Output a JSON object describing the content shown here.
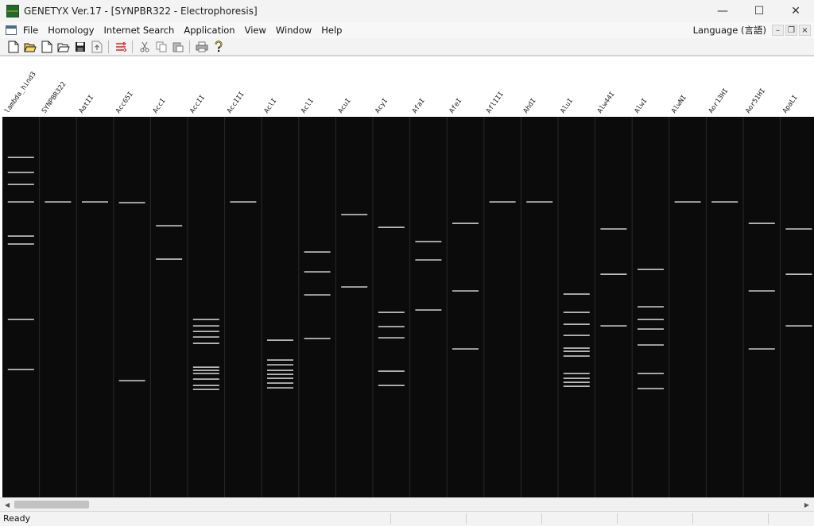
{
  "window": {
    "title": "GENETYX Ver.17 - [SYNPBR322 - Electrophoresis]",
    "minimize": "—",
    "maximize": "☐",
    "close": "✕"
  },
  "menu": {
    "items": [
      "File",
      "Homology",
      "Internet Search",
      "Application",
      "View",
      "Window",
      "Help"
    ],
    "language": "Language (言語)",
    "child_minimize": "–",
    "child_restore": "❐",
    "child_close": "×"
  },
  "toolbar": {
    "icons": [
      "new-icon",
      "open-icon",
      "new-doc-icon",
      "open-folder-icon",
      "save-icon",
      "export-icon",
      "align-icon",
      "cut-icon",
      "copy-icon",
      "paste-icon",
      "print-icon",
      "help-icon"
    ]
  },
  "gel": {
    "background": "#0b0b0b",
    "band_color": "#e6e6e6",
    "lanes": [
      {
        "name": "lambda_hind3",
        "bands": [
          197,
          216,
          231,
          253,
          296,
          306,
          401,
          464
        ]
      },
      {
        "name": "SYNPBR322",
        "bands": [
          253
        ]
      },
      {
        "name": "AatII",
        "bands": [
          253
        ]
      },
      {
        "name": "Acc65I",
        "bands": [
          254,
          478
        ]
      },
      {
        "name": "AccI",
        "bands": [
          283,
          325
        ]
      },
      {
        "name": "AccII",
        "bands": [
          401,
          409,
          416,
          423,
          431,
          461,
          465,
          469,
          476,
          484,
          489
        ]
      },
      {
        "name": "AccIII",
        "bands": [
          253
        ]
      },
      {
        "name": "AclI",
        "bands": [
          427,
          452,
          458,
          465,
          470,
          475,
          481,
          487
        ]
      },
      {
        "name": "AclI",
        "bands": [
          316,
          341,
          370,
          425
        ]
      },
      {
        "name": "AcuI",
        "bands": [
          269,
          360
        ]
      },
      {
        "name": "AcyI",
        "bands": [
          285,
          392,
          410,
          424,
          466,
          484
        ]
      },
      {
        "name": "AfaI",
        "bands": [
          303,
          326,
          389
        ]
      },
      {
        "name": "AfeI",
        "bands": [
          280,
          365,
          438
        ]
      },
      {
        "name": "AflIII",
        "bands": [
          253
        ]
      },
      {
        "name": "AhdI",
        "bands": [
          253
        ]
      },
      {
        "name": "AluI",
        "bands": [
          369,
          392,
          407,
          421,
          437,
          441,
          447,
          469,
          475,
          480,
          485
        ]
      },
      {
        "name": "Alw44I",
        "bands": [
          287,
          344,
          409
        ]
      },
      {
        "name": "AlwI",
        "bands": [
          338,
          385,
          401,
          413,
          433,
          469,
          488
        ]
      },
      {
        "name": "AlwNI",
        "bands": [
          253
        ]
      },
      {
        "name": "Aor13HI",
        "bands": [
          253
        ]
      },
      {
        "name": "Aor51HI",
        "bands": [
          280,
          365,
          438
        ]
      },
      {
        "name": "ApaLI",
        "bands": [
          287,
          344,
          409
        ]
      }
    ]
  },
  "status": {
    "text": "Ready"
  }
}
